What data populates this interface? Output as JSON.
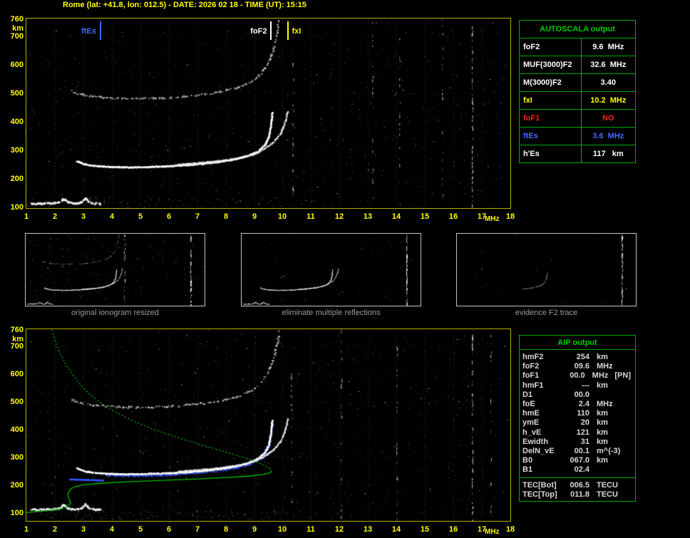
{
  "title": "Rome (lat: +41.8, lon: 012.5) - DATE: 2026 02 18 - TIME (UT): 15:15",
  "colors": {
    "axis_text": "#ffff00",
    "plot_border": "#b0b000",
    "table_border": "#00aa00",
    "table_header_text": "#00cc00",
    "caption_text": "#9a9a9a",
    "trace_white": "#ffffff",
    "trace_blue": "#3355ff",
    "profile_green": "#00c000",
    "warning_red": "#ff2020"
  },
  "autoscala": {
    "header": "AUTOSCALA output",
    "rows": [
      {
        "label": "foF2",
        "value": "9.6  MHz",
        "color": "#ffffff"
      },
      {
        "label": "MUF(3000)F2",
        "value": "32.6  MHz",
        "color": "#ffffff"
      },
      {
        "label": "M(3000)F2",
        "value": "3.40",
        "color": "#ffffff"
      },
      {
        "label": "fxI",
        "value": "10.2  MHz",
        "color": "#ffff00"
      },
      {
        "label": "foF1",
        "value": "NO",
        "color": "#ff2020"
      },
      {
        "label": "ftEs",
        "value": "3.6  MHz",
        "color": "#4169ff"
      },
      {
        "label": "h'Es",
        "value": "117   km",
        "color": "#ffffff"
      }
    ]
  },
  "thumbnails": [
    {
      "caption": "original ionogram resized",
      "traces": [
        "f2_second_hop",
        "es",
        "f2_ordinary",
        "f2_extraordinary"
      ],
      "noise_points": 170,
      "noise_columns": [
        10.35,
        16.65
      ]
    },
    {
      "caption": "eliminate multiple reflections",
      "traces": [
        "es",
        "f2_ordinary",
        "f2_extraordinary"
      ],
      "noise_points": 60,
      "noise_columns": [
        16.65
      ]
    },
    {
      "caption": "evidence F2 trace",
      "traces": [
        "f2_tail"
      ],
      "noise_points": 35,
      "noise_columns": [
        16.65
      ]
    }
  ],
  "aip": {
    "header": "AIP output",
    "rows": [
      {
        "name": "hmF2",
        "value": "254",
        "unit": "km",
        "extra": ""
      },
      {
        "name": "foF2",
        "value": "09.6",
        "unit": "MHz",
        "extra": ""
      },
      {
        "name": "foF1",
        "value": "00.0",
        "unit": "MHz",
        "extra": "[PN]"
      },
      {
        "name": "hmF1",
        "value": "---",
        "unit": "km",
        "extra": ""
      },
      {
        "name": "D1",
        "value": "00.0",
        "unit": "",
        "extra": ""
      },
      {
        "name": "foE",
        "value": "2.4",
        "unit": "MHz",
        "extra": ""
      },
      {
        "name": "hmE",
        "value": "110",
        "unit": "km",
        "extra": ""
      },
      {
        "name": "ymE",
        "value": "20",
        "unit": "km",
        "extra": ""
      },
      {
        "name": "h_vE",
        "value": "121",
        "unit": "km",
        "extra": ""
      },
      {
        "name": "Ewidth",
        "value": "31",
        "unit": "km",
        "extra": ""
      },
      {
        "name": "DelN_vE",
        "value": "00.1",
        "unit": "m^(-3)",
        "extra": ""
      },
      {
        "name": "B0",
        "value": "067.0",
        "unit": "km",
        "extra": ""
      },
      {
        "name": "B1",
        "value": "02.4",
        "unit": "",
        "extra": ""
      }
    ],
    "tec_rows": [
      {
        "name": "TEC[Bot]",
        "value": "006.5",
        "unit": "TECU"
      },
      {
        "name": "TEC[Top]",
        "value": "011.8",
        "unit": "TECU"
      }
    ]
  },
  "chart_data": {
    "plots": [
      {
        "name": "scaled ionogram",
        "type": "scatter",
        "xlabel": "MHz",
        "ylabel": "km",
        "xlim": [
          1,
          18
        ],
        "ylim": [
          95,
          760
        ],
        "xticks": [
          1,
          2,
          3,
          4,
          5,
          6,
          7,
          8,
          9,
          10,
          11,
          12,
          13,
          14,
          15,
          16,
          17,
          18
        ],
        "yticks": [
          760,
          700,
          600,
          500,
          400,
          300,
          200,
          100
        ],
        "grid": true,
        "markers": [
          {
            "label": "ftEs",
            "freq": 3.6,
            "color": "#4169ff",
            "side": "left"
          },
          {
            "label": "foF2",
            "freq": 9.6,
            "color": "#ffffff",
            "side": "left"
          },
          {
            "label": "fxI",
            "freq": 10.2,
            "color": "#ffff00",
            "side": "right"
          }
        ],
        "traces": [
          "f2_second_hop",
          "es",
          "f2_ordinary",
          "f2_extraordinary"
        ],
        "noise_columns": [
          10.35,
          13.15,
          14.1,
          15.6,
          16.65
        ],
        "noise_points": 800,
        "bottom_band": 80
      },
      {
        "name": "restored ionogram with electron density profile",
        "type": "scatter",
        "xlabel": "MHz",
        "ylabel": "km",
        "xlim": [
          1,
          18
        ],
        "ylim": [
          70,
          760
        ],
        "xticks": [
          1,
          2,
          3,
          4,
          5,
          6,
          7,
          8,
          9,
          10,
          11,
          12,
          13,
          14,
          15,
          16,
          17,
          18
        ],
        "yticks": [
          760,
          700,
          600,
          500,
          400,
          300,
          200,
          100
        ],
        "grid": true,
        "markers": [],
        "traces": [
          "f2_second_hop",
          "restored_flat",
          "restored_f2",
          "es",
          "f2_ordinary",
          "f2_extraordinary",
          "profile_top",
          "profile_bottom"
        ],
        "noise_columns": [
          10.3,
          12.05,
          14.0,
          16.65,
          17.3
        ],
        "noise_points": 700,
        "bottom_band": 140
      }
    ],
    "trace_points": {
      "es": {
        "color": "#ffffff",
        "size": 2,
        "density": 2.0,
        "jitter": 2.5,
        "keep": 0.85,
        "points": [
          [
            1.15,
            112
          ],
          [
            1.5,
            113
          ],
          [
            1.9,
            114
          ],
          [
            2.15,
            118
          ],
          [
            2.3,
            130
          ],
          [
            2.45,
            117
          ],
          [
            2.7,
            113
          ],
          [
            2.9,
            116
          ],
          [
            3.05,
            132
          ],
          [
            3.2,
            118
          ],
          [
            3.4,
            113
          ],
          [
            3.6,
            112
          ]
        ]
      },
      "f2_ordinary": {
        "color": "#ffffff",
        "size": 2,
        "density": 2.4,
        "jitter": 1.6,
        "keep": 0.93,
        "points": [
          [
            2.75,
            262
          ],
          [
            3.0,
            252
          ],
          [
            3.3,
            246
          ],
          [
            3.8,
            242
          ],
          [
            4.5,
            240
          ],
          [
            5.2,
            241
          ],
          [
            6.0,
            244
          ],
          [
            6.8,
            249
          ],
          [
            7.6,
            257
          ],
          [
            8.2,
            266
          ],
          [
            8.7,
            278
          ],
          [
            9.1,
            295
          ],
          [
            9.35,
            317
          ],
          [
            9.5,
            347
          ],
          [
            9.58,
            392
          ],
          [
            9.62,
            434
          ]
        ]
      },
      "f2_extraordinary": {
        "color": "#f0f0f0",
        "size": 2,
        "density": 1.6,
        "jitter": 1.4,
        "keep": 0.8,
        "points": [
          [
            6.3,
            250
          ],
          [
            7.0,
            255
          ],
          [
            7.8,
            263
          ],
          [
            8.5,
            274
          ],
          [
            9.0,
            287
          ],
          [
            9.35,
            305
          ],
          [
            9.65,
            327
          ],
          [
            9.9,
            357
          ],
          [
            10.07,
            397
          ],
          [
            10.17,
            440
          ]
        ]
      },
      "f2_second_hop": {
        "color": "#cccccc",
        "size": 2,
        "density": 0.9,
        "jitter": 2.4,
        "keep": 0.55,
        "points": [
          [
            2.55,
            508
          ],
          [
            2.9,
            496
          ],
          [
            3.3,
            489
          ],
          [
            3.9,
            484
          ],
          [
            4.7,
            481
          ],
          [
            5.5,
            482
          ],
          [
            6.3,
            486
          ],
          [
            7.1,
            494
          ],
          [
            7.8,
            505
          ],
          [
            8.4,
            520
          ],
          [
            8.9,
            542
          ],
          [
            9.25,
            572
          ],
          [
            9.5,
            612
          ],
          [
            9.68,
            660
          ],
          [
            9.8,
            715
          ],
          [
            9.86,
            758
          ]
        ]
      },
      "restored_flat": {
        "color": "#3355ff",
        "size": 2,
        "density": 2.2,
        "jitter": 1.0,
        "keep": 0.95,
        "points": [
          [
            2.5,
            222
          ],
          [
            3.0,
            220
          ],
          [
            3.7,
            218
          ]
        ]
      },
      "restored_f2": {
        "color": "#3355ff",
        "size": 2,
        "density": 1.4,
        "jitter": 2.4,
        "keep": 0.7,
        "points": [
          [
            3.8,
            236
          ],
          [
            4.5,
            234
          ],
          [
            5.2,
            235
          ],
          [
            6.0,
            238
          ],
          [
            6.8,
            243
          ],
          [
            7.6,
            251
          ],
          [
            8.2,
            260
          ],
          [
            8.7,
            272
          ],
          [
            9.1,
            289
          ],
          [
            9.35,
            311
          ],
          [
            9.5,
            341
          ],
          [
            9.58,
            387
          ],
          [
            9.62,
            428
          ]
        ]
      },
      "f2_tail": {
        "color": "#e0e0e0",
        "size": 2,
        "density": 1.0,
        "jitter": 1.5,
        "keep": 0.65,
        "points": [
          [
            7.2,
            252
          ],
          [
            8.0,
            261
          ],
          [
            8.6,
            273
          ],
          [
            9.05,
            290
          ],
          [
            9.3,
            312
          ],
          [
            9.45,
            340
          ],
          [
            9.55,
            380
          ],
          [
            9.6,
            425
          ]
        ]
      },
      "profile_top": {
        "color": "#00c000",
        "line": true,
        "dash": [
          2,
          3
        ],
        "points": [
          [
            1.9,
            758
          ],
          [
            2.0,
            720
          ],
          [
            2.15,
            680
          ],
          [
            2.35,
            640
          ],
          [
            2.6,
            600
          ],
          [
            2.9,
            560
          ],
          [
            3.2,
            528
          ],
          [
            3.6,
            496
          ],
          [
            4.1,
            464
          ],
          [
            4.7,
            432
          ],
          [
            5.4,
            402
          ],
          [
            6.2,
            374
          ],
          [
            7.0,
            348
          ],
          [
            7.8,
            324
          ],
          [
            8.5,
            302
          ],
          [
            9.05,
            284
          ],
          [
            9.4,
            268
          ],
          [
            9.58,
            256
          ],
          [
            9.62,
            250
          ]
        ]
      },
      "profile_bottom": {
        "color": "#00c000",
        "line": true,
        "points": [
          [
            9.62,
            250
          ],
          [
            9.55,
            243
          ],
          [
            9.3,
            237
          ],
          [
            8.8,
            231
          ],
          [
            8.0,
            226
          ],
          [
            7.0,
            221
          ],
          [
            5.8,
            216
          ],
          [
            4.6,
            211
          ],
          [
            3.7,
            206
          ],
          [
            3.0,
            200
          ],
          [
            2.7,
            193
          ],
          [
            2.55,
            184
          ],
          [
            2.48,
            172
          ],
          [
            2.46,
            158
          ],
          [
            2.52,
            144
          ],
          [
            2.56,
            133
          ],
          [
            2.42,
            122
          ],
          [
            2.2,
            113
          ],
          [
            1.8,
            108
          ],
          [
            1.3,
            103
          ],
          [
            1.0,
            100
          ]
        ]
      }
    }
  }
}
